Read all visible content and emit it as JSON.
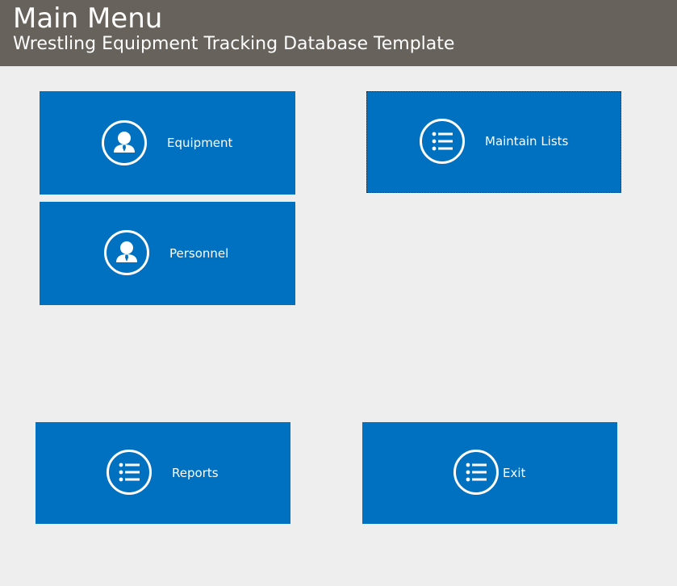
{
  "header": {
    "title": "Main Menu",
    "subtitle": "Wrestling Equipment Tracking Database Template"
  },
  "tiles": {
    "equipment": {
      "label": "Equipment",
      "icon": "person-icon"
    },
    "maintain_lists": {
      "label": "Maintain Lists",
      "icon": "list-icon"
    },
    "personnel": {
      "label": "Personnel",
      "icon": "person-icon"
    },
    "reports": {
      "label": "Reports",
      "icon": "list-icon"
    },
    "exit": {
      "label": "Exit",
      "icon": "list-icon"
    }
  },
  "colors": {
    "header_bg": "#67625b",
    "tile_bg": "#0070c0",
    "page_bg": "#eeeeee"
  }
}
